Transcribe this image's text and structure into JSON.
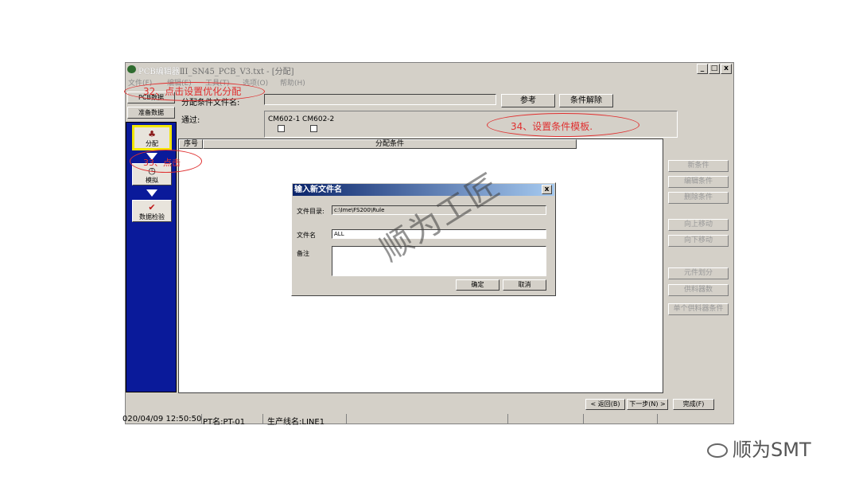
{
  "window": {
    "title": "PCB编辑器",
    "doc_title": "ⅡI_SN45_PCB_V3.txt - [分配]",
    "min_label": "_",
    "max_label": "□",
    "close_label": "x"
  },
  "menu": [
    "文件(F)",
    "编辑(E)",
    "工具(T)",
    "选项(O)",
    "帮助(H)"
  ],
  "leftnav": {
    "pcb_data": "PCB数据",
    "prep_data": "准备数据",
    "assign": "分配",
    "simulate": "模拟",
    "check": "数据检验"
  },
  "top": {
    "condition_file_label": "分配条件文件名:",
    "reference_button": "参考",
    "clear_button": "条件解除",
    "pass_label": "通过:",
    "cm_labels": "CM602-1 CM602-2"
  },
  "list": {
    "col_no": "序号",
    "col_condition": "分配条件"
  },
  "right_buttons": [
    "新条件",
    "编辑条件",
    "删除条件",
    "向上移动",
    "向下移动",
    "元件划分",
    "供料器数",
    "单个供料器条件"
  ],
  "dialog": {
    "title": "输入新文件名",
    "close": "x",
    "dir_label": "文件目录:",
    "dir_value": "c:\\Ime\\FS200\\Rule",
    "name_label": "文件名",
    "name_value": "ALL",
    "note_label": "备注",
    "ok": "确定",
    "cancel": "取消"
  },
  "bottom": {
    "back": "< 返回(B)",
    "next": "下一步(N) >",
    "finish": "完成(F)"
  },
  "status": {
    "datetime": "020/04/09 12:50:50",
    "pt": "PT名:PT-01",
    "line": "生产线名:LINE1"
  },
  "annotations": {
    "a32": "32、点击设置优化分配",
    "a33": "33、点击",
    "a34": "34、设置条件模板."
  },
  "watermark": "顺为工匠",
  "brand": "顺为SMT",
  "colors": {
    "nav_blue": "#0a1a9a",
    "annotation_red": "#e03030",
    "selected_yellow": "#f2e600"
  }
}
